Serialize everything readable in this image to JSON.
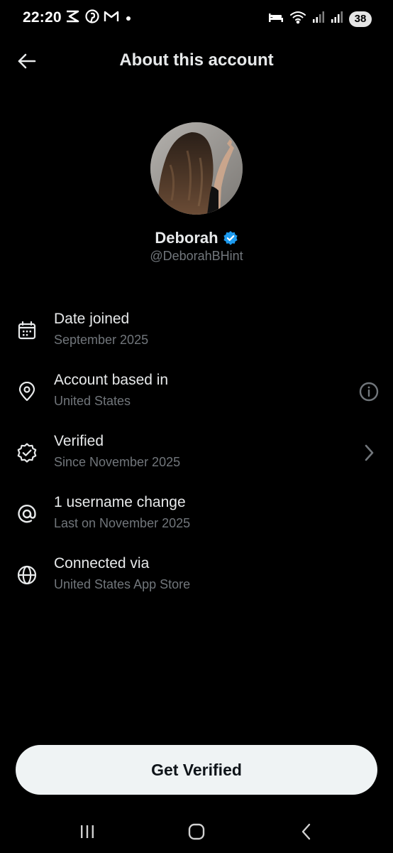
{
  "status_bar": {
    "time": "22:20",
    "battery": "38",
    "left_icons": [
      "capcut-icon",
      "pinterest-icon",
      "gmail-icon",
      "notification-dot"
    ],
    "right_icons": [
      "sleep-mode-icon",
      "wifi-icon",
      "signal-icon",
      "signal-icon",
      "battery-icon"
    ]
  },
  "header": {
    "title": "About this account",
    "back_icon": "arrow-left-icon"
  },
  "profile": {
    "name": "Deborah",
    "handle": "@DeborahBHint",
    "verified_badge_color": "#1d9bf0",
    "avatar": "profile-photo"
  },
  "info": [
    {
      "icon": "calendar-icon",
      "title": "Date joined",
      "subtitle": "September 2025"
    },
    {
      "icon": "location-pin-icon",
      "title": "Account based in",
      "subtitle": "United States",
      "trailing_icon": "info-circle-icon"
    },
    {
      "icon": "verified-badge-outline-icon",
      "title": "Verified",
      "subtitle": "Since November 2025",
      "trailing_icon": "chevron-right-icon"
    },
    {
      "icon": "at-sign-icon",
      "title": "1 username change",
      "subtitle": "Last on November 2025"
    },
    {
      "icon": "globe-icon",
      "title": "Connected via",
      "subtitle": "United States App Store"
    }
  ],
  "cta": {
    "label": "Get Verified"
  },
  "nav_bar": [
    "recent-apps-icon",
    "home-icon",
    "back-icon"
  ],
  "colors": {
    "background": "#000000",
    "primary_text": "#e7e9ea",
    "secondary_text": "#71767b",
    "button_bg": "#eff3f4",
    "button_text": "#0f1419"
  }
}
